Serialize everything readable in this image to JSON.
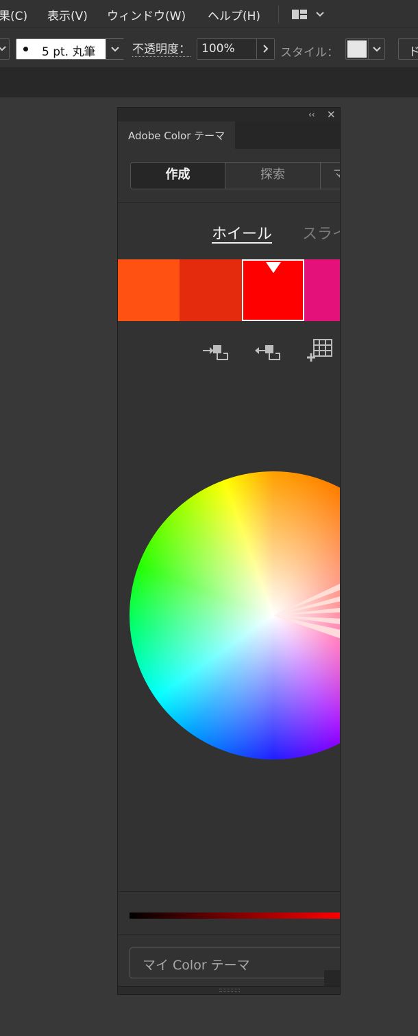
{
  "menubar": {
    "items": [
      "効果(C)",
      "表示(V)",
      "ウィンドウ(W)",
      "ヘルプ(H)"
    ],
    "visible_text": [
      "果(C)",
      "表示(V)",
      "ウィンドウ(W)",
      "ヘルプ(H)"
    ]
  },
  "controlbar": {
    "brush": "5 pt. 丸筆",
    "opacity_label": "不透明度：",
    "opacity_value": "100%",
    "style_label": "スタイル：",
    "doc_setup_partial": "ド"
  },
  "panel": {
    "tab_title": "Adobe Color テーマ",
    "mode_tabs": [
      "作成",
      "探索",
      "マ"
    ],
    "active_mode": "作成",
    "view_tabs": [
      "ホイール",
      "スライ"
    ],
    "active_view": "ホイール",
    "swatches": [
      "#ff5111",
      "#e52b0e",
      "#ff0000",
      "#e5117a"
    ],
    "selected_swatch_index": 2,
    "brightness_slider": {
      "from": "#000000",
      "to": "#ff0000"
    },
    "library_dropdown": "マイ Color テーマ"
  }
}
